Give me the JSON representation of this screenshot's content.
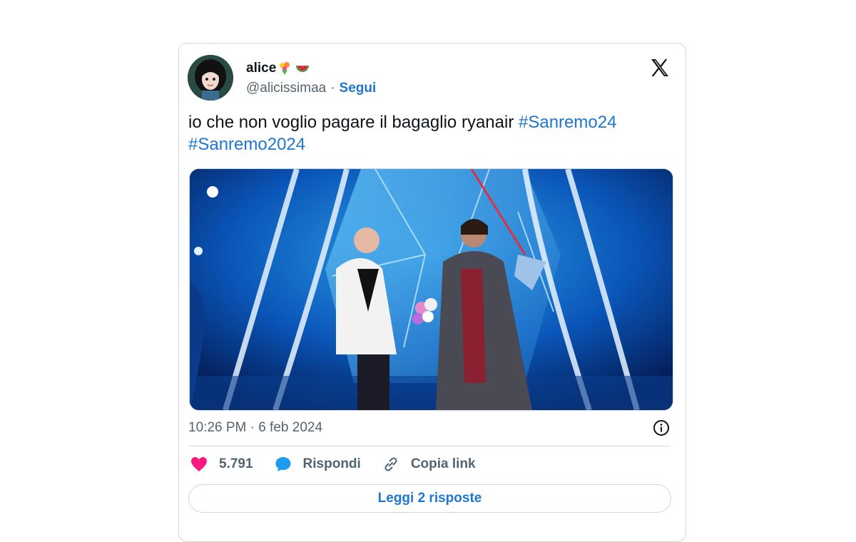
{
  "author": {
    "display_name": "alice",
    "handle": "@alicissimaa",
    "separator": "·",
    "follow_label": "Segui"
  },
  "tweet": {
    "text": "io che non voglio pagare il bagaglio ryanair ",
    "hashtag1": "#Sanremo24",
    "hashtag2": "#Sanremo2024",
    "timestamp": "10:26 PM · 6 feb 2024"
  },
  "actions": {
    "likes": "5.791",
    "reply_label": "Rispondi",
    "copy_link_label": "Copia link"
  },
  "replies_button": "Leggi 2 risposte",
  "colors": {
    "link": "#1d76d2",
    "heart": "#f91880",
    "reply_bubble": "#1d9bf0",
    "border": "#cfd9de"
  },
  "icons": [
    "x-logo-icon",
    "bouquet-emoji-icon",
    "watermelon-emoji-icon",
    "heart-icon",
    "speech-bubble-icon",
    "link-icon",
    "info-icon"
  ]
}
